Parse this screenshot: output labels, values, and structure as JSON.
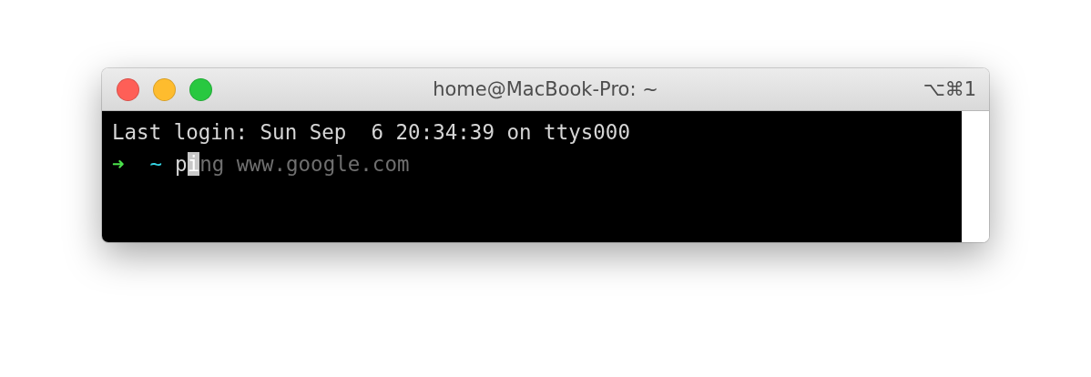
{
  "window": {
    "title": "home@MacBook-Pro: ~",
    "shortcut": "⌥⌘1"
  },
  "lines": [
    {
      "kind": "text",
      "text": "Last login: Sun Sep  6 20:34:39 on ttys000"
    },
    {
      "kind": "prompt",
      "arrow": "➜",
      "dir": "~",
      "typed": "p",
      "cursor": "i",
      "suggestion": "ng www.google.com"
    }
  ]
}
